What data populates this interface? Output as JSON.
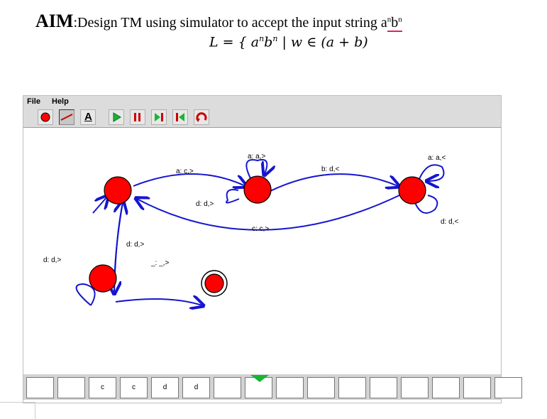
{
  "header": {
    "aim_label": "AIM",
    "aim_text": ":Design TM using simulator to accept the input string a",
    "aim_sup1": "n",
    "aim_b": "b",
    "aim_sup2": "n",
    "formula_start": "L = { a",
    "formula_sup1": "n",
    "formula_b": "b",
    "formula_sup2": "n",
    "formula_end": " | w ∈ (a + b)"
  },
  "menu": {
    "file": "File",
    "help": "Help"
  },
  "toolbar": {
    "items": [
      "state-tool",
      "transition-tool",
      "text-tool",
      "run",
      "pause",
      "step",
      "reset",
      "undo"
    ],
    "text_tool_glyph": "A"
  },
  "diagram": {
    "labels": {
      "q0_q1_top": "a: c,>",
      "q1_q0_lower": "d: d,>",
      "q1_self": "a: a,>",
      "q1_q2": "b: d,<",
      "q2_self_top": "a: a,<",
      "q2_self_bottom": "d: d,<",
      "q2_q0": "c: c,>",
      "q0_q3": "d: d,>",
      "q3_self": "d: d,>",
      "q3_accept": "_: _,>"
    },
    "colors": {
      "state": "#ff0000",
      "edge": "#1515d0",
      "head": "#19b532"
    }
  },
  "tape": {
    "cells": [
      "",
      "",
      "c",
      "c",
      "d",
      "d",
      "",
      "",
      "",
      "",
      "",
      "",
      "",
      "",
      "",
      ""
    ]
  }
}
